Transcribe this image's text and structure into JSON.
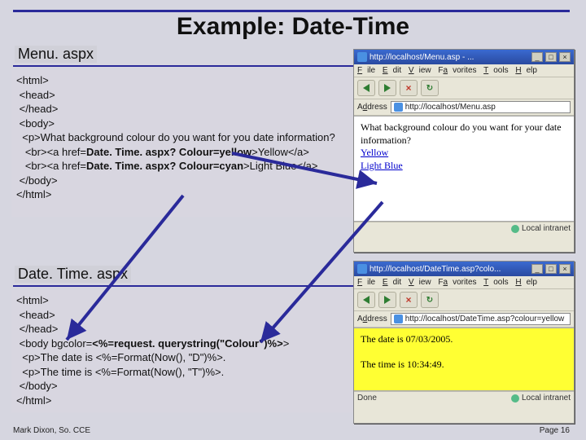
{
  "title": "Example: Date-Time",
  "section1_label": "Menu. aspx",
  "section2_label": "Date. Time. aspx",
  "code1": {
    "l1": "<html>",
    "l2": " <head>",
    "l3": " </head>",
    "l4": " <body>",
    "l5": "  <p>What background colour do you want for you date information?",
    "l6a": "   <br><a href=",
    "l6b": "Date. Time. aspx? Colour=yellow",
    "l6c": ">Yellow</a>",
    "l7a": "   <br><a href=",
    "l7b": "Date. Time. aspx? Colour=cyan",
    "l7c": ">Light Blue</a>",
    "l8": " </body>",
    "l9": "</html>"
  },
  "code2": {
    "l1": "<html>",
    "l2": " <head>",
    "l3": " </head>",
    "l4a": " <body bgcolor=",
    "l4b": "<%=request. querystring(\"Colour\")%>",
    "l4c": ">",
    "l5": "  <p>The date is <%=Format(Now(), \"D\")%>.",
    "l6": "  <p>The time is <%=Format(Now(), \"T\")%>.",
    "l7": " </body>",
    "l8": "</html>"
  },
  "browser1": {
    "title": "http://localhost/Menu.asp - ...",
    "menu": {
      "file": "File",
      "edit": "Edit",
      "view": "View",
      "fav": "Favorites",
      "tools": "Tools",
      "help": "Help"
    },
    "addr_label": "Address",
    "url": "http://localhost/Menu.asp",
    "content": {
      "q": "What background colour do you want for your date information?",
      "link1": "Yellow",
      "link2": "Light Blue"
    },
    "status_left": "",
    "status_right": "Local intranet"
  },
  "browser2": {
    "title": "http://localhost/DateTime.asp?colo...",
    "menu": {
      "file": "File",
      "edit": "Edit",
      "view": "View",
      "fav": "Favorites",
      "tools": "Tools",
      "help": "Help"
    },
    "addr_label": "Address",
    "url": "http://localhost/DateTime.asp?colour=yellow",
    "content": {
      "date": "The date is 07/03/2005.",
      "time": "The time is 10:34:49."
    },
    "status_left": "Done",
    "status_right": "Local intranet"
  },
  "footer_left": "Mark Dixon, So. CCE",
  "footer_right": "Page 16"
}
